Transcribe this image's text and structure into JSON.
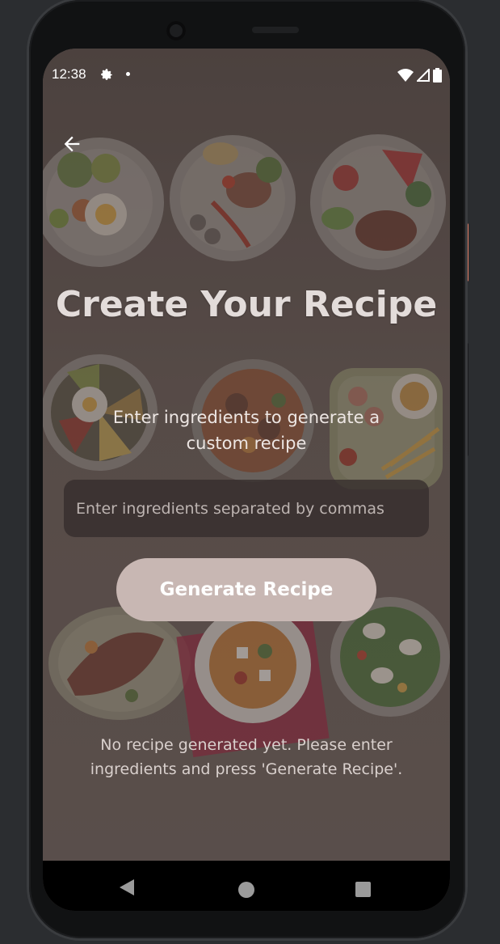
{
  "status_bar": {
    "time": "12:38",
    "icons": [
      "gear-icon",
      "notification-dot-icon",
      "wifi-icon",
      "cellular-icon",
      "battery-icon"
    ]
  },
  "header": {
    "back_icon": "arrow-left-icon"
  },
  "main": {
    "title": "Create Your Recipe",
    "subtitle": "Enter ingredients to generate a custom recipe",
    "ingredients_input": {
      "value": "",
      "placeholder": "Enter ingredients separated by commas"
    },
    "generate_button_label": "Generate Recipe",
    "empty_message": "No recipe generated yet. Please enter ingredients and press 'Generate Recipe'."
  },
  "nav_bar": {
    "icons": [
      "back-triangle-icon",
      "home-circle-icon",
      "recents-square-icon"
    ]
  },
  "colors": {
    "screen_bg": "#5c514e",
    "button_bg": "#c8b7b3",
    "input_bg": "#342d2b"
  }
}
